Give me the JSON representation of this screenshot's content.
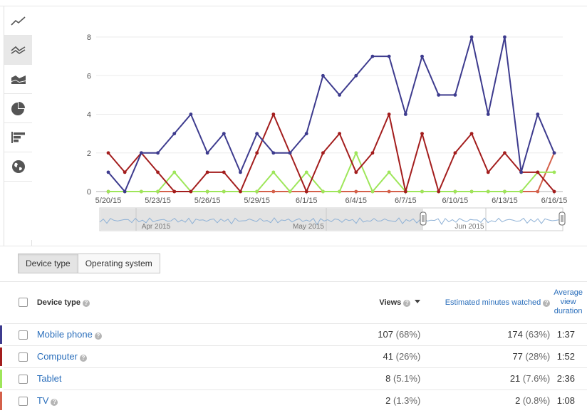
{
  "sidebar": {
    "items": [
      {
        "icon": "line-chart-icon",
        "active": false
      },
      {
        "icon": "multi-line-chart-icon",
        "active": true
      },
      {
        "icon": "stacked-area-chart-icon",
        "active": false
      },
      {
        "icon": "pie-chart-icon",
        "active": false
      },
      {
        "icon": "bar-chart-icon",
        "active": false
      },
      {
        "icon": "globe-map-icon",
        "active": false
      }
    ]
  },
  "chart_data": {
    "type": "line",
    "x": [
      "5/20/15",
      "5/21/15",
      "5/22/15",
      "5/23/15",
      "5/24/15",
      "5/25/15",
      "5/26/15",
      "5/27/15",
      "5/28/15",
      "5/29/15",
      "5/30/15",
      "5/31/15",
      "6/1/15",
      "6/2/15",
      "6/3/15",
      "6/4/15",
      "6/5/15",
      "6/6/15",
      "6/7/15",
      "6/8/15",
      "6/9/15",
      "6/10/15",
      "6/11/15",
      "6/12/15",
      "6/13/15",
      "6/14/15",
      "6/15/15",
      "6/16/15"
    ],
    "xticks": [
      "5/20/15",
      "5/23/15",
      "5/26/15",
      "5/29/15",
      "6/1/15",
      "6/4/15",
      "6/7/15",
      "6/10/15",
      "6/13/15",
      "6/16/15"
    ],
    "yticks": [
      "0",
      "2",
      "4",
      "6",
      "8"
    ],
    "ylim": [
      0,
      8.5
    ],
    "grid": true,
    "series": [
      {
        "name": "Mobile phone",
        "color": "#3d3b8e",
        "values": [
          1,
          0,
          2,
          2,
          3,
          4,
          2,
          3,
          1,
          3,
          2,
          2,
          3,
          6,
          5,
          6,
          7,
          7,
          4,
          7,
          5,
          5,
          8,
          4,
          8,
          1,
          4,
          2
        ]
      },
      {
        "name": "Computer",
        "color": "#a31d1d",
        "values": [
          2,
          1,
          2,
          1,
          0,
          0,
          1,
          1,
          0,
          2,
          4,
          2,
          0,
          2,
          3,
          1,
          2,
          4,
          0,
          3,
          0,
          2,
          3,
          1,
          2,
          1,
          1,
          0
        ]
      },
      {
        "name": "Tablet",
        "color": "#9ee65a",
        "values": [
          0,
          0,
          0,
          0,
          1,
          0,
          0,
          0,
          0,
          0,
          1,
          0,
          1,
          0,
          0,
          2,
          0,
          1,
          0,
          0,
          0,
          0,
          0,
          0,
          0,
          0,
          1,
          1
        ]
      },
      {
        "name": "TV",
        "color": "#d4604a",
        "values": [
          0,
          0,
          0,
          0,
          0,
          0,
          0,
          0,
          0,
          0,
          0,
          0,
          0,
          0,
          0,
          0,
          0,
          0,
          0,
          0,
          0,
          0,
          0,
          0,
          0,
          0,
          0,
          2
        ]
      }
    ],
    "overview": {
      "labels": [
        "Apr 2015",
        "May 2015",
        "Jun 2015"
      ]
    }
  },
  "tabs": [
    {
      "label": "Device type",
      "active": true
    },
    {
      "label": "Operating system",
      "active": false
    }
  ],
  "table": {
    "headers": {
      "name": "Device type",
      "views": "Views",
      "minutes": "Estimated minutes watched",
      "duration_line1": "Average",
      "duration_line2": "view",
      "duration_line3": "duration"
    },
    "rows": [
      {
        "name": "Mobile phone",
        "color": "#3d3b8e",
        "views": "107",
        "views_pct": "(68%)",
        "minutes": "174",
        "minutes_pct": "(63%)",
        "duration": "1:37"
      },
      {
        "name": "Computer",
        "color": "#a31d1d",
        "views": "41",
        "views_pct": "(26%)",
        "minutes": "77",
        "minutes_pct": "(28%)",
        "duration": "1:52"
      },
      {
        "name": "Tablet",
        "color": "#9ee65a",
        "views": "8",
        "views_pct": "(5.1%)",
        "minutes": "21",
        "minutes_pct": "(7.6%)",
        "duration": "2:36"
      },
      {
        "name": "TV",
        "color": "#d4604a",
        "views": "2",
        "views_pct": "(1.3%)",
        "minutes": "2",
        "minutes_pct": "(0.8%)",
        "duration": "1:08"
      }
    ]
  }
}
